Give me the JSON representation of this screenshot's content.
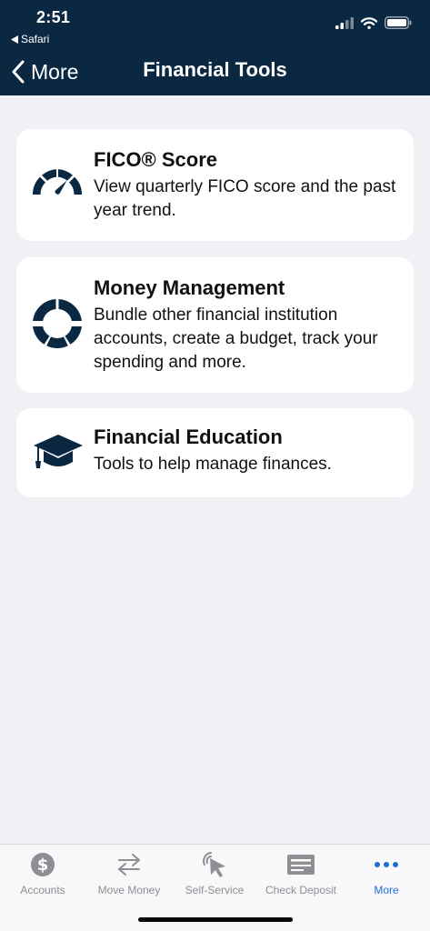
{
  "status_bar": {
    "time": "2:51",
    "back_app": "Safari"
  },
  "nav": {
    "back_label": "More",
    "title": "Financial Tools"
  },
  "cards": [
    {
      "title": "FICO® Score",
      "description": "View quarterly FICO score and the past year trend.",
      "icon": "gauge-icon"
    },
    {
      "title": "Money Management",
      "description": "Bundle other financial institution accounts, create a budget, track your spending and more.",
      "icon": "donut-chart-icon"
    },
    {
      "title": "Financial Education",
      "description": "Tools to help manage finances.",
      "icon": "graduation-cap-icon"
    }
  ],
  "tabbar": {
    "items": [
      {
        "label": "Accounts",
        "icon": "dollar-coin-icon"
      },
      {
        "label": "Move Money",
        "icon": "transfer-arrows-icon"
      },
      {
        "label": "Self-Service",
        "icon": "cursor-click-icon"
      },
      {
        "label": "Check Deposit",
        "icon": "check-icon"
      },
      {
        "label": "More",
        "icon": "more-dots-icon"
      }
    ],
    "active_index": 4
  },
  "colors": {
    "header_bg": "#0a2842",
    "accent": "#1d6fd6",
    "icon_dark": "#0a2842",
    "background": "#f1f1f5"
  }
}
